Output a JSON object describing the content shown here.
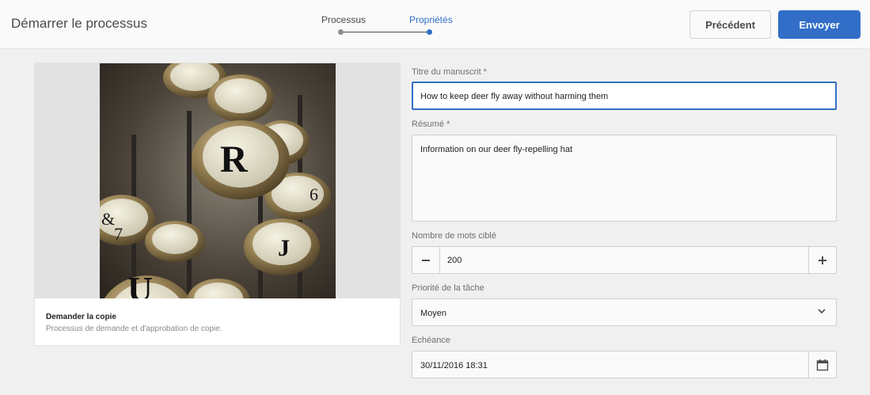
{
  "header": {
    "title": "Démarrer le processus",
    "steps": [
      {
        "label": "Processus",
        "state": "done"
      },
      {
        "label": "Propriétés",
        "state": "current"
      }
    ],
    "prev_label": "Précédent",
    "send_label": "Envoyer"
  },
  "card": {
    "title": "Demander la copie",
    "description": "Processus de demande et d'approbation de copie."
  },
  "form": {
    "title_label": "Titre du manuscrit *",
    "title_value": "How to keep deer fly away without harming them",
    "summary_label": "Résumé *",
    "summary_value": "Information on our deer fly-repelling hat",
    "wordcount_label": "Nombre de mots ciblé",
    "wordcount_value": "200",
    "priority_label": "Priorité de la tâche",
    "priority_value": "Moyen",
    "due_label": "Echéance",
    "due_value": "30/11/2016 18:31"
  },
  "colors": {
    "accent": "#326ec8",
    "background": "#f0f0f0",
    "header_bg": "#fafafa"
  },
  "icons": [
    "minus-icon",
    "plus-icon",
    "chevron-down-icon",
    "calendar-icon"
  ]
}
